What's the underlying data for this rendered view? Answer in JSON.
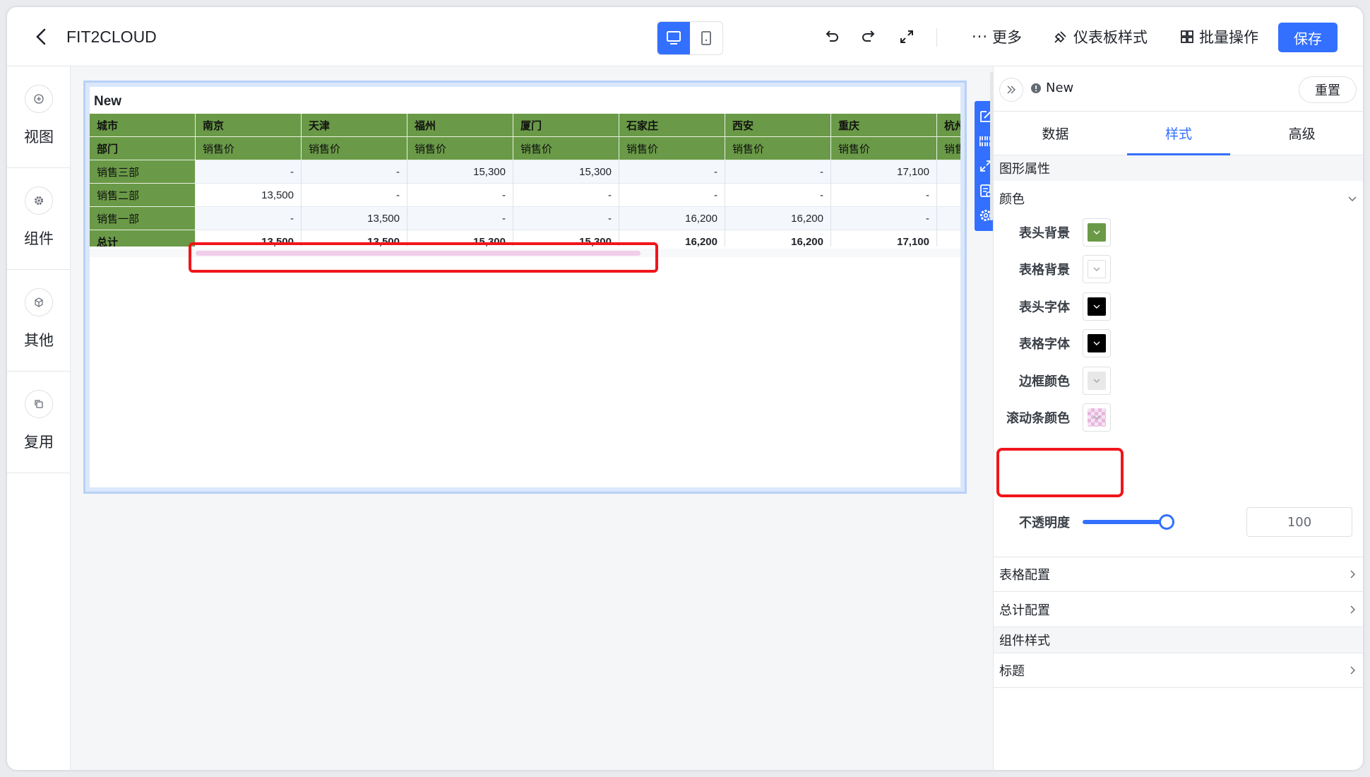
{
  "app": {
    "title": "FIT2CLOUD"
  },
  "toolbar": {
    "more_label": "更多",
    "dashboard_style_label": "仪表板样式",
    "batch_label": "批量操作",
    "save_label": "保存"
  },
  "leftnav": {
    "items": [
      {
        "label": "视图"
      },
      {
        "label": "组件"
      },
      {
        "label": "其他"
      },
      {
        "label": "复用"
      }
    ]
  },
  "chart": {
    "title": "New",
    "table": {
      "corner_top": "城市",
      "corner_bottom": "部门",
      "cities": [
        "南京",
        "天津",
        "福州",
        "厦门",
        "石家庄",
        "西安",
        "重庆",
        "杭州"
      ],
      "measure": "销售价",
      "rows": [
        {
          "label": "销售三部",
          "values": [
            "-",
            "-",
            "15,300",
            "15,300",
            "-",
            "-",
            "17,100",
            "-"
          ]
        },
        {
          "label": "销售二部",
          "values": [
            "13,500",
            "-",
            "-",
            "-",
            "-",
            "-",
            "-",
            "-"
          ]
        },
        {
          "label": "销售一部",
          "values": [
            "-",
            "13,500",
            "-",
            "-",
            "16,200",
            "16,200",
            "-",
            "-"
          ]
        }
      ],
      "total": {
        "label": "总计",
        "values": [
          "13,500",
          "13,500",
          "15,300",
          "15,300",
          "16,200",
          "16,200",
          "17,100",
          "-"
        ]
      }
    },
    "scrollbar_color": "#f1cdea",
    "header_bg": "#6a9a47"
  },
  "panel": {
    "chart_name": "New",
    "reset_label": "重置",
    "tabs": [
      {
        "label": "数据"
      },
      {
        "label": "样式"
      },
      {
        "label": "高级"
      }
    ],
    "active_tab": "样式",
    "section_graphic": "图形属性",
    "color_group": "颜色",
    "props": [
      {
        "label": "表头背景",
        "color": "#6a9a47"
      },
      {
        "label": "表格背景",
        "color": "#ffffff"
      },
      {
        "label": "表头字体",
        "color": "#000000"
      },
      {
        "label": "表格字体",
        "color": "#000000"
      },
      {
        "label": "边框颜色",
        "color": "#e8e8e8"
      },
      {
        "label": "滚动条颜色",
        "color": "#e8b7e0"
      }
    ],
    "opacity_label": "不透明度",
    "opacity_value": "100",
    "table_config": "表格配置",
    "total_config": "总计配置",
    "section_component": "组件样式",
    "title_row": "标题"
  }
}
